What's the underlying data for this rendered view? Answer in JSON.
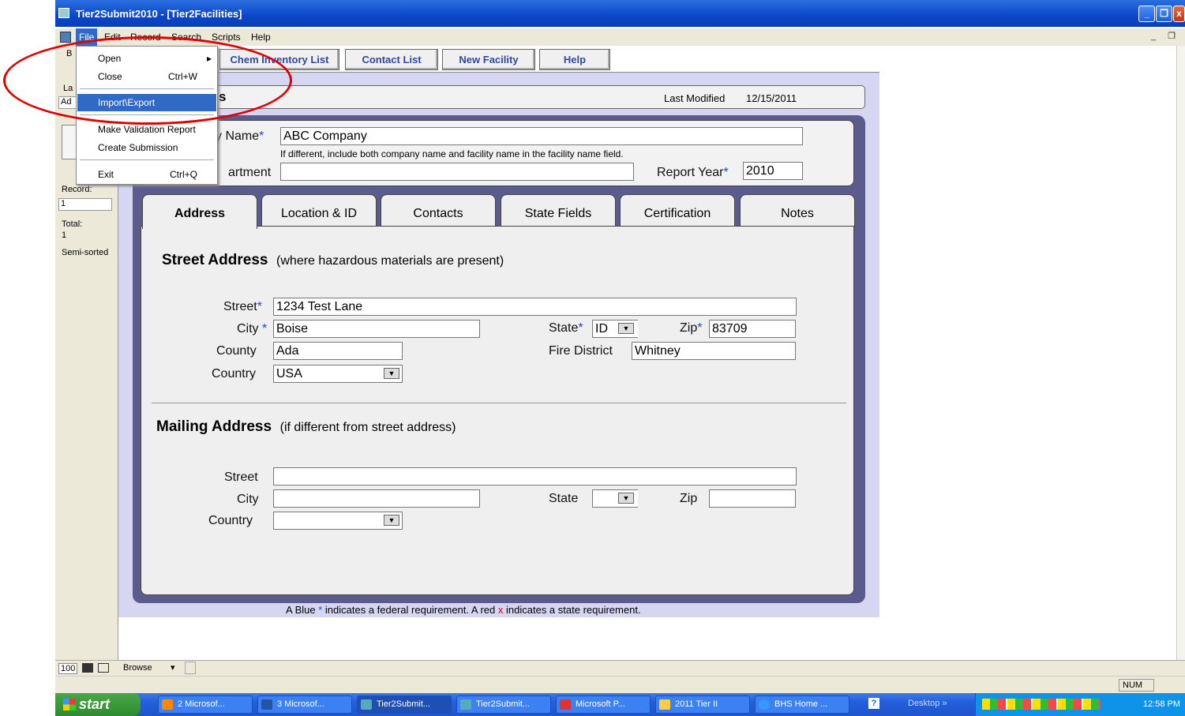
{
  "window": {
    "title": "Tier2Submit2010 - [Tier2Facilities]"
  },
  "menubar": {
    "items": [
      "File",
      "Edit",
      "Record",
      "Search",
      "Scripts",
      "Help"
    ]
  },
  "file_menu": {
    "open": "Open",
    "close": "Close",
    "close_shortcut": "Ctrl+W",
    "import_export": "Import\\Export",
    "make_validation": "Make Validation Report",
    "create_submission": "Create Submission",
    "exit": "Exit",
    "exit_shortcut": "Ctrl+Q"
  },
  "status_pane": {
    "b": "B",
    "la": "La",
    "ad": "Ad",
    "record_label": "Record:",
    "record_value": "1",
    "total_label": "Total:",
    "total_value": "1",
    "sort_status": "Semi-sorted"
  },
  "nav_tabs": [
    "Chem Inventory List",
    "Contact List",
    "New Facility",
    "Help"
  ],
  "header": {
    "title_fragment": "s",
    "last_modified_label": "Last Modified",
    "last_modified_value": "12/15/2011"
  },
  "facility": {
    "name_label": "y Name",
    "name_value": "ABC Company",
    "name_hint": "If different, include both company name and facility name in the facility name field.",
    "department_label": "artment",
    "department_value": "",
    "report_year_label": "Report Year",
    "report_year_value": "2010"
  },
  "form_tabs": [
    "Address",
    "Location & ID",
    "Contacts",
    "State Fields",
    "Certification",
    "Notes"
  ],
  "street_address": {
    "heading": "Street Address",
    "subheading": "(where hazardous materials are present)",
    "street_label": "Street",
    "street_value": "1234 Test Lane",
    "city_label": "City",
    "city_value": "Boise",
    "state_label": "State",
    "state_value": "ID",
    "zip_label": "Zip",
    "zip_value": "83709",
    "county_label": "County",
    "county_value": "Ada",
    "fire_label": "Fire District",
    "fire_value": "Whitney",
    "country_label": "Country",
    "country_value": "USA"
  },
  "mailing_address": {
    "heading": "Mailing Address",
    "subheading": "(if different from street address)",
    "street_label": "Street",
    "street_value": "",
    "city_label": "City",
    "city_value": "",
    "state_label": "State",
    "state_value": "",
    "zip_label": "Zip",
    "zip_value": "",
    "country_label": "Country",
    "country_value": ""
  },
  "footnote": {
    "part1": "A Blue",
    "part2": "indicates a federal requirement.  A red",
    "part3": "x",
    "part4": "indicates a state requirement."
  },
  "bottom_nav": {
    "zoom": "100",
    "mode": "Browse"
  },
  "statusbar": {
    "num": "NUM"
  },
  "taskbar": {
    "start": "start",
    "items": [
      "2 Microsof...",
      "3 Microsof...",
      "Tier2Submit...",
      "Tier2Submit...",
      "Microsoft P...",
      "2011 Tier II",
      "BHS Home ..."
    ],
    "desktop": "Desktop",
    "clock": "12:58 PM"
  },
  "colors": {
    "required_blue": "#2244dd",
    "state_red": "#e00000",
    "form_bg": "#d6d6f2",
    "panel_border": "#5b5b8e"
  }
}
